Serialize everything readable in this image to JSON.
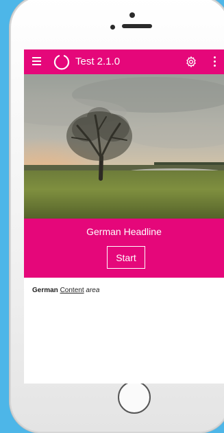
{
  "app": {
    "title": "Test 2.1.0",
    "menu_icon": "menu-icon",
    "logo_icon": "app-logo-icon",
    "settings_icon": "gear-icon",
    "more_icon": "more-vertical-icon"
  },
  "hero": {
    "image": "landscape-tree-photo"
  },
  "headline": {
    "title": "German Headline",
    "start_label": "Start"
  },
  "content": {
    "bold": "German",
    "link": "Content",
    "italic": "area"
  },
  "colors": {
    "background": "#4db6e8",
    "accent": "#e5077a",
    "text": "#222222"
  }
}
